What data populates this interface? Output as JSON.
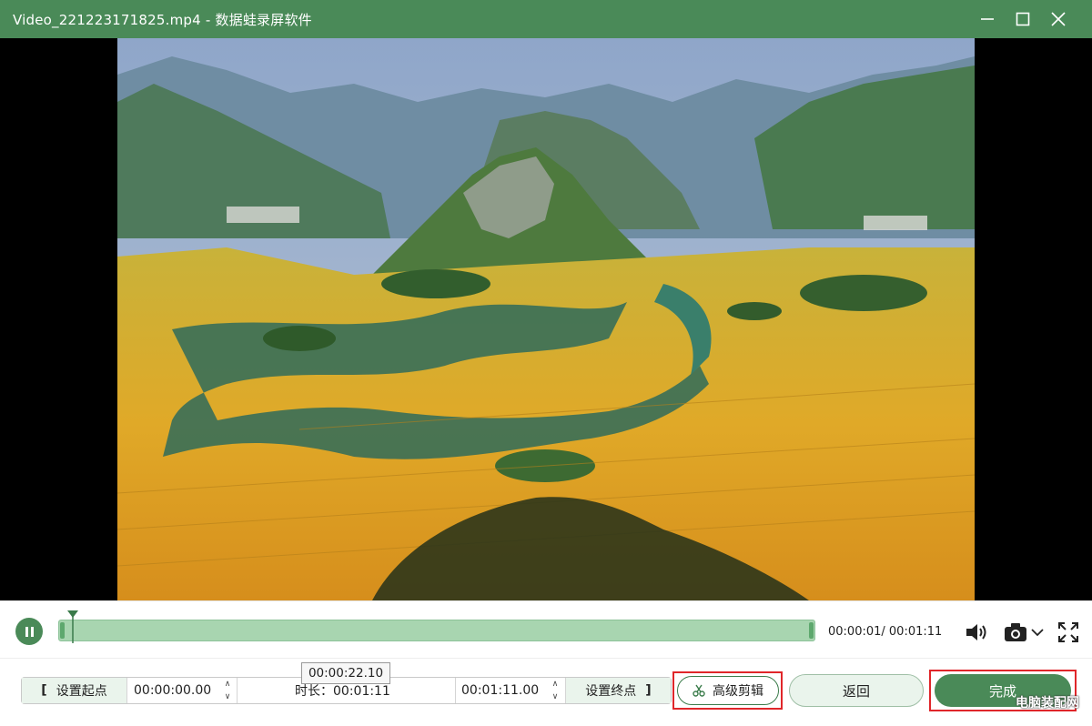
{
  "window": {
    "title": "Video_221223171825.mp4  -  数据蛙录屏软件",
    "minimize_icon": "minimize-icon",
    "maximize_icon": "maximize-icon",
    "close_icon": "close-icon"
  },
  "video": {
    "description_icon": "landscape-video-frame"
  },
  "playback": {
    "play_state_icon": "pause-icon",
    "progress": 0.015,
    "time_readout": "00:00:01/ 00:01:11",
    "volume_icon": "speaker-icon",
    "screenshot_icon": "camera-icon",
    "fullscreen_icon": "fullscreen-icon"
  },
  "tooltip": {
    "text": "00:00:22.10"
  },
  "trim": {
    "set_start_label": "设置起点",
    "start_time": "00:00:00.00",
    "duration_label": "时长：00:01:11",
    "end_time": "00:01:11.00",
    "set_end_label": "设置终点"
  },
  "actions": {
    "advanced_edit_label": "高级剪辑",
    "back_label": "返回",
    "done_label": "完成"
  },
  "watermark": {
    "text": "电脑装配网"
  },
  "colors": {
    "brand_green": "#4a8a58",
    "highlight_red": "#e0262a"
  }
}
